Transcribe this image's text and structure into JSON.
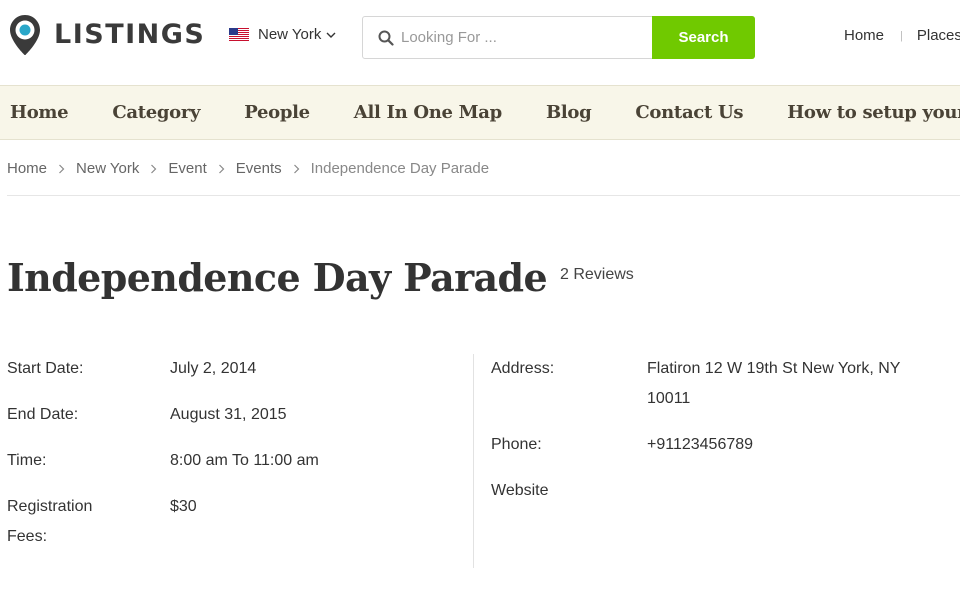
{
  "header": {
    "logo_text": "LISTINGS",
    "city": "New York",
    "search": {
      "placeholder": "Looking For ...",
      "button_label": "Search"
    },
    "top_links": [
      "Home",
      "Places"
    ]
  },
  "colors": {
    "accent_green": "#70c900",
    "nav_background": "#f8f6e9",
    "logo_pin": "#2aa7c9"
  },
  "nav": [
    "Home",
    "Category",
    "People",
    "All In One Map",
    "Blog",
    "Contact Us",
    "How to setup your site"
  ],
  "breadcrumb": [
    "Home",
    "New York",
    "Event",
    "Events",
    "Independence Day Parade"
  ],
  "listing": {
    "title": "Independence Day Parade",
    "reviews": "2 Reviews",
    "left": [
      {
        "label": "Start Date:",
        "value": "July 2, 2014"
      },
      {
        "label": "End Date:",
        "value": "August 31, 2015"
      },
      {
        "label": "Time:",
        "value": "8:00 am To 11:00 am"
      },
      {
        "label": "Registration Fees:",
        "value": "$30"
      }
    ],
    "right": [
      {
        "label": "Address:",
        "value": "Flatiron 12 W 19th St New York, NY 10011"
      },
      {
        "label": "Phone:",
        "value": "+91123456789"
      },
      {
        "label": "Website",
        "value": ""
      }
    ]
  }
}
